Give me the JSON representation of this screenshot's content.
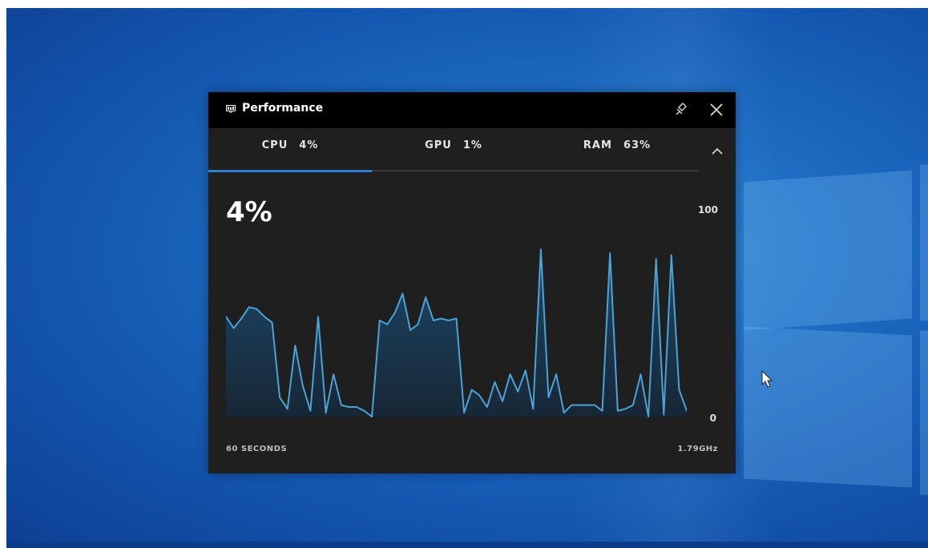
{
  "widget": {
    "title": "Performance",
    "title_icon": "performance-monitor-icon",
    "pin_icon": "pin-icon",
    "close_icon": "close-icon",
    "collapse_icon": "chevron-up-icon",
    "accent": "#2f7fd0",
    "line_color": "#4aa3d8"
  },
  "tabs": [
    {
      "label": "CPU",
      "value": "4%",
      "active": true
    },
    {
      "label": "GPU",
      "value": "1%",
      "active": false
    },
    {
      "label": "RAM",
      "value": "63%",
      "active": false
    }
  ],
  "main": {
    "current_value": "4%",
    "axis_max": "100",
    "axis_min": "0",
    "time_span_label": "60 SECONDS",
    "clock_speed": "1.79GHz"
  },
  "chart_data": {
    "type": "area",
    "ylim": [
      0,
      100
    ],
    "values": [
      52,
      46,
      51,
      57,
      56,
      52,
      49,
      10,
      4,
      37,
      16,
      3,
      52,
      2,
      22,
      6,
      5,
      5,
      3,
      0,
      50,
      48,
      54,
      64,
      45,
      48,
      62,
      50,
      51,
      50,
      51,
      2,
      14,
      11,
      5,
      18,
      8,
      22,
      13,
      24,
      4,
      87,
      10,
      22,
      2,
      6,
      6,
      6,
      6,
      3,
      85,
      3,
      4,
      6,
      22,
      0,
      82,
      1,
      84,
      14,
      3
    ],
    "grid": false
  }
}
